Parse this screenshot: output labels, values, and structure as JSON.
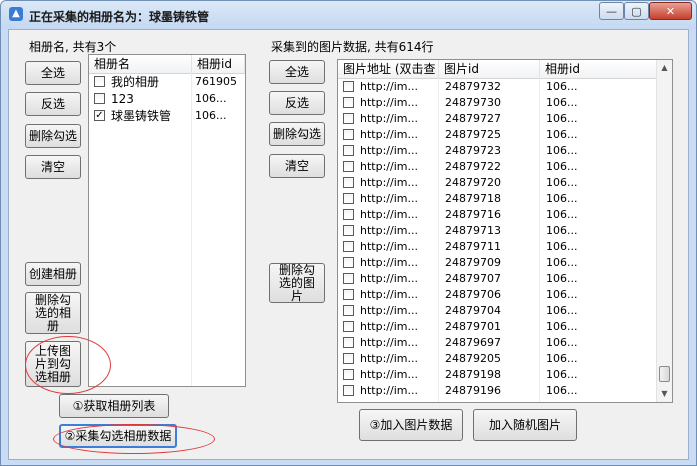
{
  "window": {
    "title": "正在采集的相册名为：球墨铸铁管",
    "controls": {
      "minimize": "—",
      "maximize": "▢",
      "close": "✕"
    }
  },
  "left": {
    "header": "相册名, 共有3个",
    "buttons": {
      "select_all": "全选",
      "invert": "反选",
      "delete_checked": "删除勾选",
      "clear": "清空",
      "create": "创建相册",
      "delete_checked_albums": "删除勾选的相册",
      "upload": "上传图片到勾选相册"
    },
    "columns": [
      "相册名",
      "相册id"
    ],
    "albums": [
      {
        "name": "我的相册",
        "id": "761905",
        "checked": false
      },
      {
        "name": "123",
        "id": "106...",
        "checked": false
      },
      {
        "name": "球墨铸铁管",
        "id": "106...",
        "checked": true
      }
    ],
    "fetch_button": "①获取相册列表",
    "collect_button": "②采集勾选相册数据"
  },
  "right": {
    "header": "采集到的图片数据, 共有614行",
    "buttons": {
      "select_all": "全选",
      "invert": "反选",
      "delete_checked": "删除勾选",
      "clear": "清空",
      "delete_checked_images": "删除勾选的图片"
    },
    "columns": [
      "图片地址 (双击查",
      "图片id",
      "相册id"
    ],
    "rows": [
      {
        "url": "http://im...",
        "pid": "24879732",
        "aid": "106..."
      },
      {
        "url": "http://im...",
        "pid": "24879730",
        "aid": "106..."
      },
      {
        "url": "http://im...",
        "pid": "24879727",
        "aid": "106..."
      },
      {
        "url": "http://im...",
        "pid": "24879725",
        "aid": "106..."
      },
      {
        "url": "http://im...",
        "pid": "24879723",
        "aid": "106..."
      },
      {
        "url": "http://im...",
        "pid": "24879722",
        "aid": "106..."
      },
      {
        "url": "http://im...",
        "pid": "24879720",
        "aid": "106..."
      },
      {
        "url": "http://im...",
        "pid": "24879718",
        "aid": "106..."
      },
      {
        "url": "http://im...",
        "pid": "24879716",
        "aid": "106..."
      },
      {
        "url": "http://im...",
        "pid": "24879713",
        "aid": "106..."
      },
      {
        "url": "http://im...",
        "pid": "24879711",
        "aid": "106..."
      },
      {
        "url": "http://im...",
        "pid": "24879709",
        "aid": "106..."
      },
      {
        "url": "http://im...",
        "pid": "24879707",
        "aid": "106..."
      },
      {
        "url": "http://im...",
        "pid": "24879706",
        "aid": "106..."
      },
      {
        "url": "http://im...",
        "pid": "24879704",
        "aid": "106..."
      },
      {
        "url": "http://im...",
        "pid": "24879701",
        "aid": "106..."
      },
      {
        "url": "http://im...",
        "pid": "24879697",
        "aid": "106..."
      },
      {
        "url": "http://im...",
        "pid": "24879205",
        "aid": "106..."
      },
      {
        "url": "http://im...",
        "pid": "24879198",
        "aid": "106..."
      },
      {
        "url": "http://im...",
        "pid": "24879196",
        "aid": "106..."
      }
    ],
    "add_images_button": "③加入图片数据",
    "add_random_button": "加入随机图片"
  },
  "colors": {
    "title_bg": "#c9dcf3",
    "client_bg": "#f0f0f0",
    "annotation": "#e03a3a",
    "collect_border": "#3b7fd8"
  }
}
